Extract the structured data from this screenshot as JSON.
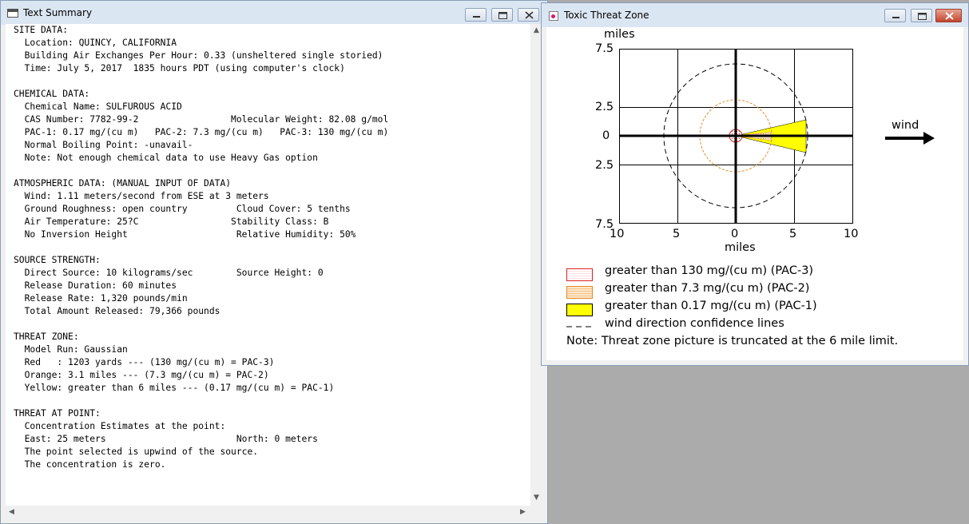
{
  "summary_window": {
    "title": "Text Summary",
    "lines": [
      "SITE DATA:",
      "  Location: QUINCY, CALIFORNIA",
      "  Building Air Exchanges Per Hour: 0.33 (unsheltered single storied)",
      "  Time: July 5, 2017  1835 hours PDT (using computer's clock)",
      "",
      "CHEMICAL DATA:",
      "  Chemical Name: SULFUROUS ACID",
      "  CAS Number: 7782-99-2                 Molecular Weight: 82.08 g/mol",
      "  PAC-1: 0.17 mg/(cu m)   PAC-2: 7.3 mg/(cu m)   PAC-3: 130 mg/(cu m)",
      "  Normal Boiling Point: -unavail-",
      "  Note: Not enough chemical data to use Heavy Gas option",
      "",
      "ATMOSPHERIC DATA: (MANUAL INPUT OF DATA)",
      "  Wind: 1.11 meters/second from ESE at 3 meters",
      "  Ground Roughness: open country         Cloud Cover: 5 tenths",
      "  Air Temperature: 25?C                 Stability Class: B",
      "  No Inversion Height                    Relative Humidity: 50%",
      "",
      "SOURCE STRENGTH:",
      "  Direct Source: 10 kilograms/sec        Source Height: 0",
      "  Release Duration: 60 minutes",
      "  Release Rate: 1,320 pounds/min",
      "  Total Amount Released: 79,366 pounds",
      "",
      "THREAT ZONE:",
      "  Model Run: Gaussian",
      "  Red   : 1203 yards --- (130 mg/(cu m) = PAC-3)",
      "  Orange: 3.1 miles --- (7.3 mg/(cu m) = PAC-2)",
      "  Yellow: greater than 6 miles --- (0.17 mg/(cu m) = PAC-1)",
      "",
      "THREAT AT POINT:",
      "  Concentration Estimates at the point:",
      "  East: 25 meters                        North: 0 meters",
      "  The point selected is upwind of the source.",
      "  The concentration is zero."
    ]
  },
  "threat_window": {
    "title": "Toxic Threat Zone",
    "y_unit": "miles",
    "x_unit": "miles",
    "y_ticks": [
      "7.5",
      "2.5",
      "0",
      "2.5",
      "7.5"
    ],
    "x_ticks": [
      "10",
      "5",
      "0",
      "5",
      "10"
    ],
    "wind_label": "wind",
    "legend": [
      {
        "label": "greater than 130 mg/(cu m) (PAC-3)",
        "color": "#e02020"
      },
      {
        "label": "greater than 7.3 mg/(cu m) (PAC-2)",
        "color": "#f08a24"
      },
      {
        "label": "greater than 0.17 mg/(cu m) (PAC-1)",
        "color": "#ffff00"
      },
      {
        "label": "wind direction confidence lines",
        "color": "#000000"
      }
    ],
    "note": "Note: Threat zone picture is truncated at the 6 mile limit."
  }
}
